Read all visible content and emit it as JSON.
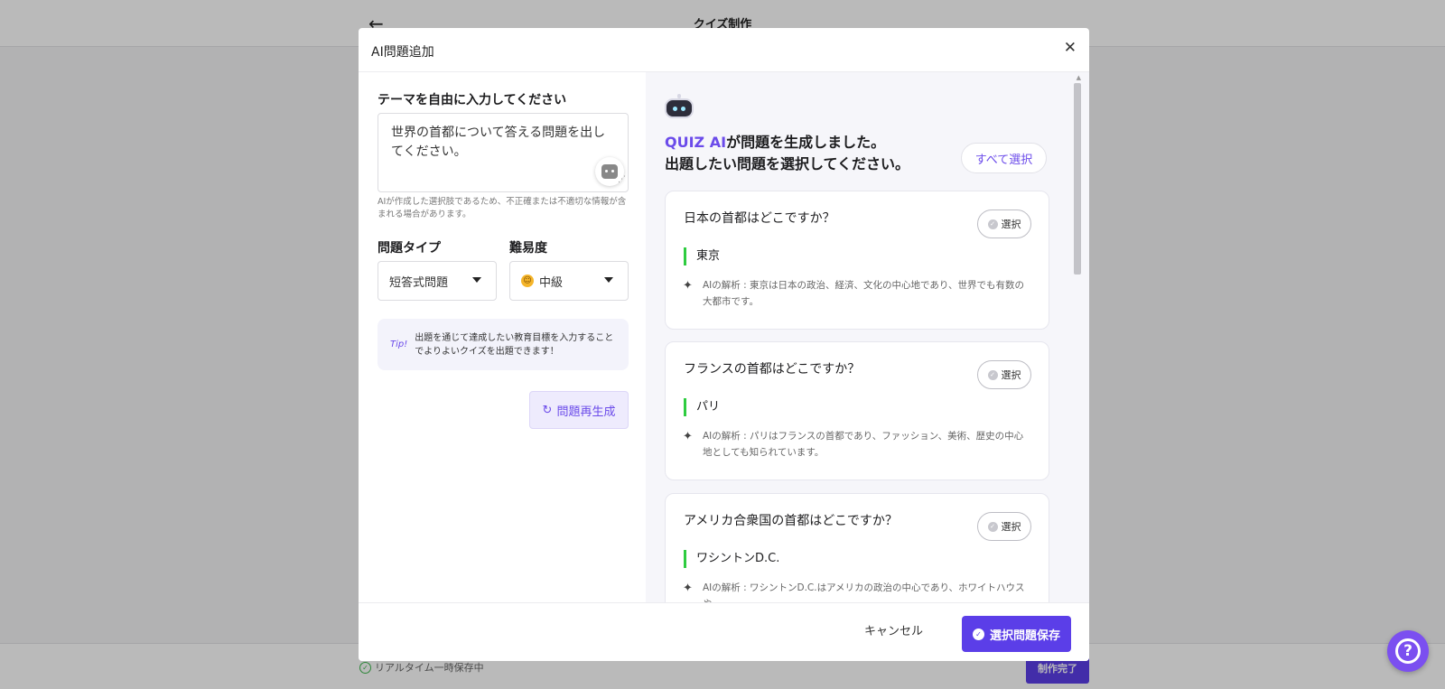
{
  "background": {
    "back_icon": "arrow-left-icon",
    "page_title": "クイズ制作",
    "autosave_text": "リアルタイム一時保存中",
    "done_button": "制作完了"
  },
  "modal": {
    "title": "AI問題追加",
    "close_icon": "close-icon"
  },
  "left_panel": {
    "theme_label": "テーマを自由に入力してください",
    "theme_value": "世界の首都について答える問題を出してください。",
    "disclaimer": "AIが作成した選択肢であるため、不正確または不適切な情報が含まれる場合があります。",
    "type_label": "問題タイプ",
    "type_value": "短答式問題",
    "difficulty_label": "難易度",
    "difficulty_value": "中級",
    "tip_tag": "Tip!",
    "tip_text": "出題を通じて達成したい教育目標を入力することでよりよいクイズを出題できます！",
    "regenerate_button": "問題再生成"
  },
  "right_panel": {
    "brand": "QUIZ AI",
    "gen_title_suffix": "が問題を生成しました。",
    "gen_title_line2": "出題したい問題を選択してください。",
    "select_all_button": "すべて選択",
    "questions": [
      {
        "question": "日本の首都はどこですか？",
        "pick_label": "選択",
        "answer": "東京",
        "explanation": "AIの解析 : 東京は日本の政治、経済、文化の中心地であり、世界でも有数の大都市です。"
      },
      {
        "question": "フランスの首都はどこですか？",
        "pick_label": "選択",
        "answer": "パリ",
        "explanation": "AIの解析 : パリはフランスの首都であり、ファッション、美術、歴史の中心地としても知られています。"
      },
      {
        "question": "アメリカ合衆国の首都はどこですか？",
        "pick_label": "選択",
        "answer": "ワシントンD.C.",
        "explanation": "AIの解析 : ワシントンD.C.はアメリカの政治の中心であり、ホワイトハウスや"
      }
    ]
  },
  "footer": {
    "cancel_button": "キャンセル",
    "save_button": "選択問題保存"
  },
  "colors": {
    "accent": "#5b3ee8",
    "brand_text": "#6b4bea",
    "answer_bar": "#2ecc40"
  }
}
